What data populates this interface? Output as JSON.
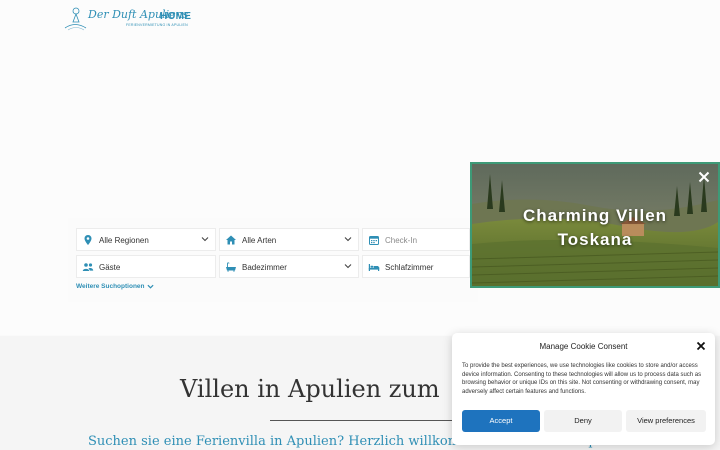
{
  "header": {
    "logo_title": "Der Duft Apuliens",
    "logo_subtitle": "FERIENVERMIETUNG IN APULIEN",
    "nav_home": "HOME"
  },
  "search": {
    "region": "Alle Regionen",
    "type": "Alle Arten",
    "checkin_placeholder": "Check-In",
    "guests": "Gäste",
    "bathrooms": "Badezimmer",
    "bedrooms": "Schlafzimmer",
    "more_options": "Weitere Suchoptionen",
    "icons": {
      "region": "map-pin-icon",
      "type": "home-icon",
      "checkin": "calendar-icon",
      "guests": "users-icon",
      "bathrooms": "bathtub-icon",
      "bedrooms": "bed-icon"
    }
  },
  "promo": {
    "title_line1": "Charming Villen",
    "title_line2": "Toskana"
  },
  "content": {
    "heading": "Villen in Apulien zum",
    "subheading": "Suchen sie eine Ferienvilla in Apulien? Herzlich willkommen auf Der Duft Apuliens!"
  },
  "cookie": {
    "title": "Manage Cookie Consent",
    "text": "To provide the best experiences, we use technologies like cookies to store and/or access device information. Consenting to these technologies will allow us to process data such as browsing behavior or unique IDs on this site. Not consenting or withdrawing consent, may adversely affect certain features and functions.",
    "accept": "Accept",
    "deny": "Deny",
    "view": "View preferences"
  },
  "colors": {
    "accent": "#2f8fb5",
    "accept_button": "#1e73be",
    "promo_border": "#3d9a77"
  }
}
